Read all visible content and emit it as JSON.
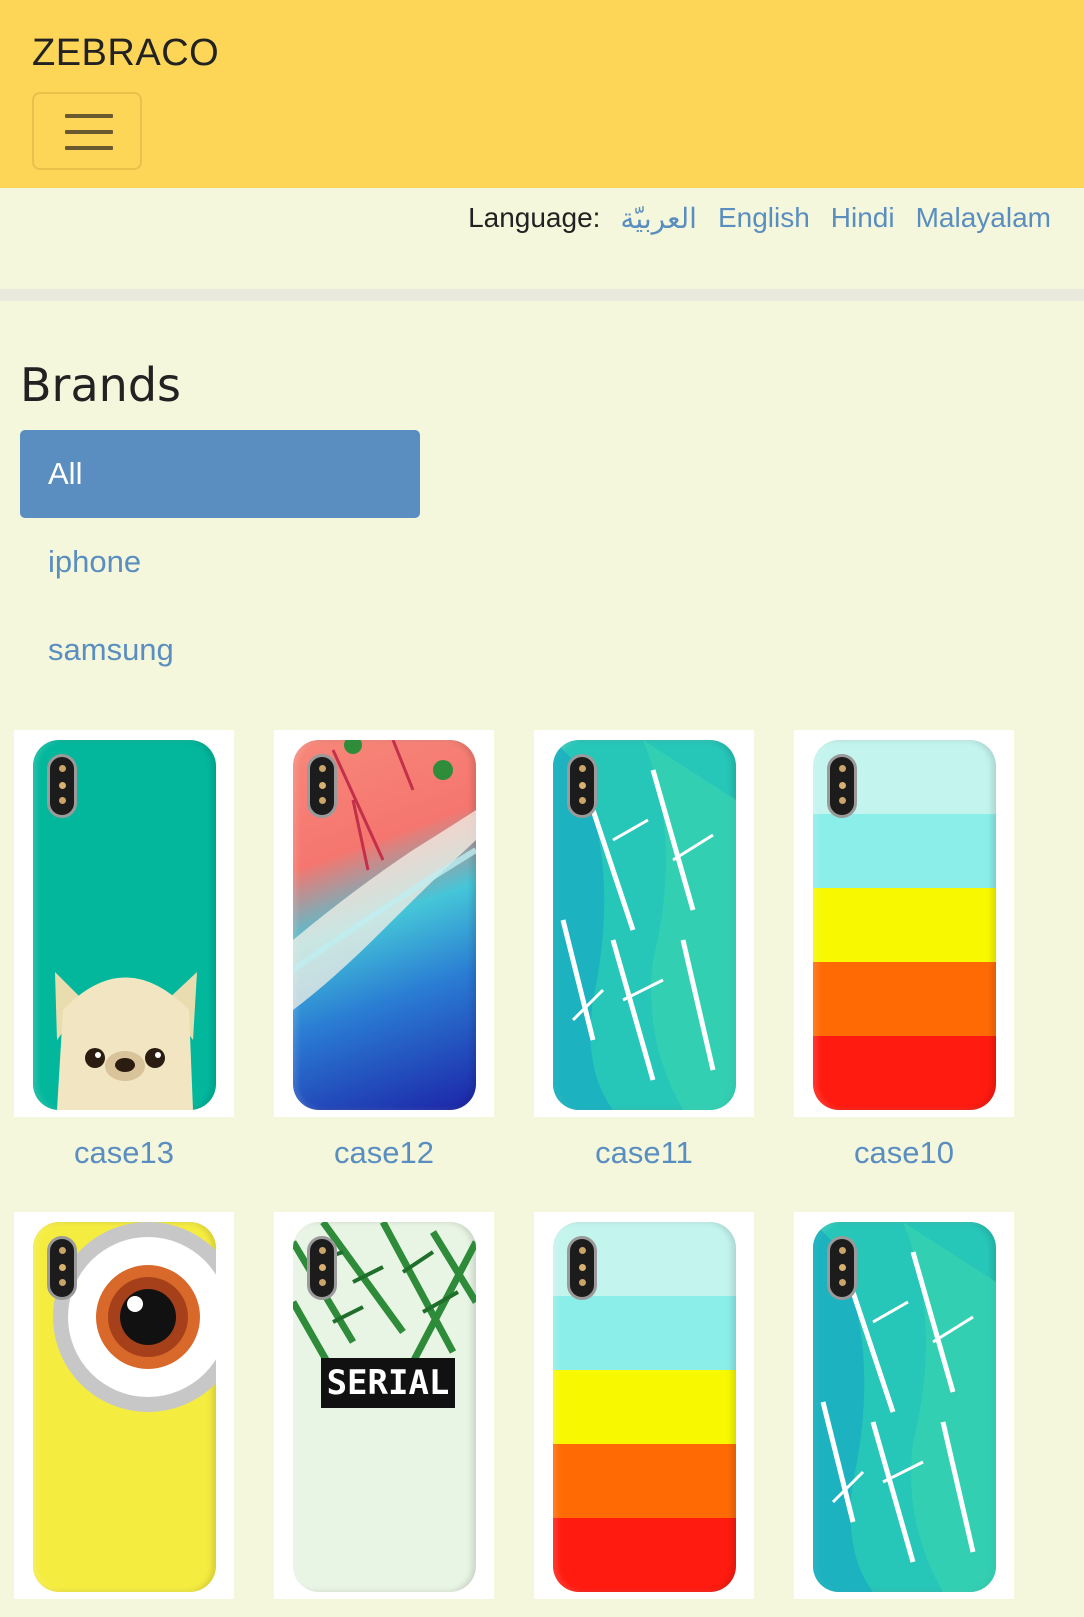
{
  "navbar": {
    "brand": "ZEBRACO",
    "toggle_icon": "hamburger-menu-icon"
  },
  "language": {
    "label": "Language:",
    "options": [
      "العربيّة",
      "English",
      "Hindi",
      "Malayalam"
    ]
  },
  "brands": {
    "title": "Brands",
    "items": [
      {
        "label": "All",
        "active": true
      },
      {
        "label": "iphone",
        "active": false
      },
      {
        "label": "samsung",
        "active": false
      }
    ]
  },
  "products": [
    {
      "name": "case13",
      "design": "teal case with cream french bulldog"
    },
    {
      "name": "case12",
      "design": "pink beach with palm shadows and blue sea"
    },
    {
      "name": "case11",
      "design": "turquoise watercolor banana leaves"
    },
    {
      "name": "case10",
      "design": "pastel cyan, yellow, orange, red stripes"
    },
    {
      "name": "",
      "design": "yellow with minion goggle eye"
    },
    {
      "name": "",
      "design": "green palm leaves with SERIAL text",
      "overlay_text": "SERIAL"
    },
    {
      "name": "",
      "design": "cyan and yellow stripes"
    },
    {
      "name": "",
      "design": "turquoise watercolor banana leaves"
    }
  ],
  "colors": {
    "navbar": "#fed657",
    "page_bg": "#f4f7dc",
    "accent": "#5a8ec0"
  }
}
